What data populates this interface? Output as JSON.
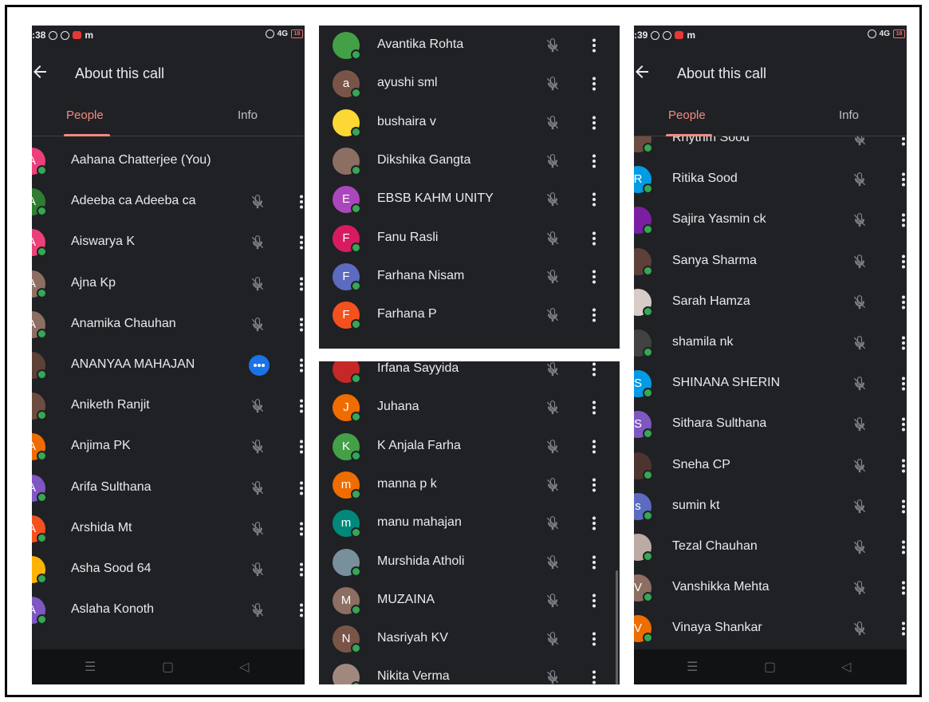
{
  "panel1": {
    "status_time": ":38",
    "status_m": "m",
    "status_net": "4G",
    "status_battery": "18",
    "title": "About this call",
    "tabs": [
      "People",
      "Info"
    ],
    "participants": [
      {
        "name": "Aahana Chatterjee (You)",
        "initial": "A",
        "color": "#ec407a",
        "state": "none"
      },
      {
        "name": "Adeeba ca Adeeba ca",
        "initial": "A",
        "color": "#2e7d32",
        "state": "muted"
      },
      {
        "name": "Aiswarya K",
        "initial": "A",
        "color": "#ec407a",
        "state": "muted"
      },
      {
        "name": "Ajna Kp",
        "initial": "A",
        "color": "#8d6e63",
        "state": "muted"
      },
      {
        "name": "Anamika Chauhan",
        "initial": "A",
        "color": "#8d6e63",
        "state": "muted"
      },
      {
        "name": "ANANYAA MAHAJAN",
        "initial": "",
        "color": "#5d4037",
        "state": "presenting"
      },
      {
        "name": "Aniketh Ranjit",
        "initial": "",
        "color": "#6d4c41",
        "state": "muted"
      },
      {
        "name": "Anjima PK",
        "initial": "A",
        "color": "#ef6c00",
        "state": "muted"
      },
      {
        "name": "Arifa Sulthana",
        "initial": "A",
        "color": "#7e57c2",
        "state": "muted"
      },
      {
        "name": "Arshida Mt",
        "initial": "A",
        "color": "#f4511e",
        "state": "muted"
      },
      {
        "name": "Asha Sood 64",
        "initial": "",
        "color": "#ffb300",
        "state": "muted"
      },
      {
        "name": "Aslaha Konoth",
        "initial": "A",
        "color": "#7e57c2",
        "state": "muted"
      }
    ],
    "nav": [
      "☰",
      "▢",
      "◁"
    ]
  },
  "panel2a": {
    "participants": [
      {
        "name": "Avantika Rohta",
        "initial": "",
        "color": "#43a047",
        "state": "muted"
      },
      {
        "name": "ayushi sml",
        "initial": "a",
        "color": "#795548",
        "state": "muted"
      },
      {
        "name": "bushaira v",
        "initial": "",
        "color": "#fdd835",
        "state": "muted"
      },
      {
        "name": "Dikshika Gangta",
        "initial": "",
        "color": "#8d6e63",
        "state": "muted"
      },
      {
        "name": "EBSB KAHM UNITY",
        "initial": "E",
        "color": "#ab47bc",
        "state": "muted"
      },
      {
        "name": "Fanu Rasli",
        "initial": "F",
        "color": "#d81b60",
        "state": "muted"
      },
      {
        "name": "Farhana Nisam",
        "initial": "F",
        "color": "#5c6bc0",
        "state": "muted"
      },
      {
        "name": "Farhana P",
        "initial": "F",
        "color": "#f4511e",
        "state": "muted"
      }
    ]
  },
  "panel2b": {
    "participants": [
      {
        "name": "Irfana Sayyida",
        "initial": "",
        "color": "#c62828",
        "state": "muted"
      },
      {
        "name": "Juhana",
        "initial": "J",
        "color": "#ef6c00",
        "state": "muted"
      },
      {
        "name": "K Anjala Farha",
        "initial": "K",
        "color": "#43a047",
        "state": "muted"
      },
      {
        "name": "manna p k",
        "initial": "m",
        "color": "#ef6c00",
        "state": "muted"
      },
      {
        "name": "manu mahajan",
        "initial": "m",
        "color": "#00897b",
        "state": "muted"
      },
      {
        "name": "Murshida Atholi",
        "initial": "",
        "color": "#78909c",
        "state": "muted"
      },
      {
        "name": "MUZAINA",
        "initial": "M",
        "color": "#8d6e63",
        "state": "muted"
      },
      {
        "name": "Nasriyah KV",
        "initial": "N",
        "color": "#795548",
        "state": "muted"
      },
      {
        "name": "Nikita Verma",
        "initial": "",
        "color": "#a1887f",
        "state": "muted"
      }
    ]
  },
  "panel3": {
    "status_time": ":39",
    "status_m": "m",
    "status_net": "4G",
    "status_battery": "18",
    "title": "About this call",
    "tabs": [
      "People",
      "Info"
    ],
    "participants": [
      {
        "name": "Rhythm Sood",
        "initial": "",
        "color": "#6d4c41",
        "state": "muted"
      },
      {
        "name": "Ritika Sood",
        "initial": "R",
        "color": "#039be5",
        "state": "muted"
      },
      {
        "name": "Sajira Yasmin ck",
        "initial": "",
        "color": "#7b1fa2",
        "state": "muted"
      },
      {
        "name": "Sanya Sharma",
        "initial": "",
        "color": "#5d4037",
        "state": "muted"
      },
      {
        "name": "Sarah Hamza",
        "initial": "",
        "color": "#d7ccc8",
        "state": "muted"
      },
      {
        "name": "shamila nk",
        "initial": "",
        "color": "#424242",
        "state": "muted"
      },
      {
        "name": "SHINANA SHERIN",
        "initial": "S",
        "color": "#039be5",
        "state": "muted"
      },
      {
        "name": "Sithara Sulthana",
        "initial": "S",
        "color": "#7e57c2",
        "state": "muted"
      },
      {
        "name": "Sneha CP",
        "initial": "",
        "color": "#4e342e",
        "state": "muted"
      },
      {
        "name": "sumin kt",
        "initial": "s",
        "color": "#5c6bc0",
        "state": "muted"
      },
      {
        "name": "Tezal Chauhan",
        "initial": "",
        "color": "#bcaaa4",
        "state": "muted"
      },
      {
        "name": "Vanshikka Mehta",
        "initial": "V",
        "color": "#8d6e63",
        "state": "muted"
      },
      {
        "name": "Vinaya Shankar",
        "initial": "V",
        "color": "#ef6c00",
        "state": "muted"
      }
    ],
    "nav": [
      "☰",
      "▢",
      "◁"
    ]
  }
}
